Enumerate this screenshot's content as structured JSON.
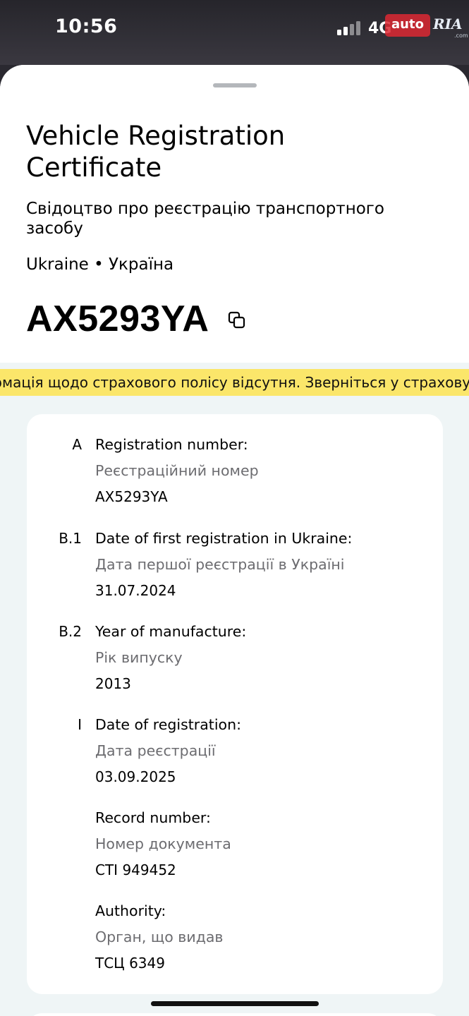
{
  "status_bar": {
    "time": "10:56",
    "network": "4G",
    "watermark": {
      "auto": "auto",
      "ria": "RIA",
      "com": ".com"
    }
  },
  "header": {
    "title": "Vehicle Registration Certificate",
    "subtitle": "Свідоцтво про реєстрацію транспортного засобу",
    "country": "Ukraine • Україна",
    "plate": "AX5293YA",
    "copy_icon": "copy-icon"
  },
  "banner": {
    "text": "Інформація щодо страхового полісу відсутня. Зверніться у страхову компанію",
    "color": "#fbe66a"
  },
  "fields": [
    {
      "code": "A",
      "label_en": "Registration number:",
      "label_ua": "Реєстраційний номер",
      "value": "AX5293YA"
    },
    {
      "code": "B.1",
      "label_en": "Date of first registration in Ukraine:",
      "label_ua": "Дата першої реєстрації в Україні",
      "value": "31.07.2024"
    },
    {
      "code": "B.2",
      "label_en": "Year of manufacture:",
      "label_ua": "Рік випуску",
      "value": "2013"
    },
    {
      "code": "I",
      "label_en": "Date of registration:",
      "label_ua": "Дата реєстрації",
      "value": "03.09.2025"
    },
    {
      "code": "",
      "label_en": "Record number:",
      "label_ua": "Номер документа",
      "value": "СТІ 949452"
    },
    {
      "code": "",
      "label_en": "Authority:",
      "label_ua": "Орган, що видав",
      "value": "ТСЦ 6349"
    }
  ]
}
